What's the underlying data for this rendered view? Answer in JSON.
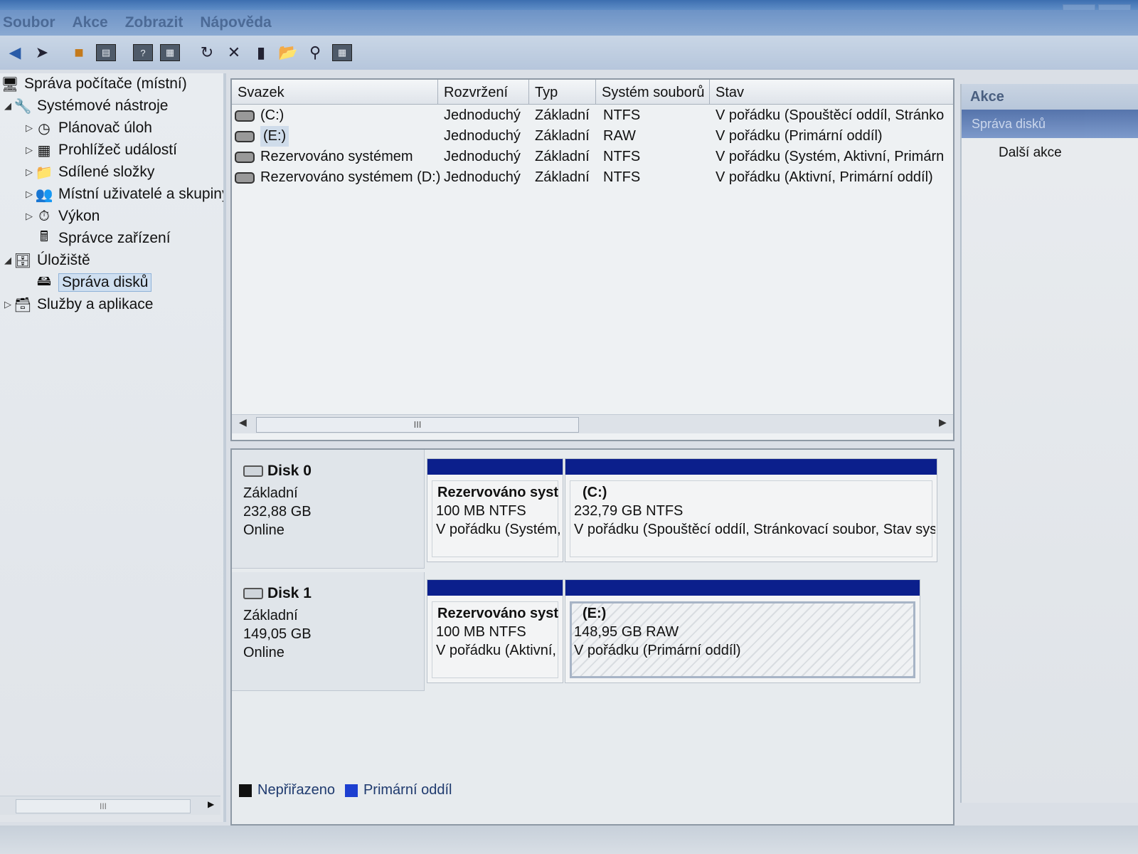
{
  "menu": [
    "Soubor",
    "Akce",
    "Zobrazit",
    "Nápověda"
  ],
  "tree": {
    "root": "Správa počítače (místní)",
    "system_tools": "Systémové nástroje",
    "task_scheduler": "Plánovač úloh",
    "event_viewer": "Prohlížeč událostí",
    "shared_folders": "Sdílené složky",
    "local_users": "Místní uživatelé a skupiny",
    "performance": "Výkon",
    "device_manager": "Správce zařízení",
    "storage": "Úložiště",
    "disk_management": "Správa disků",
    "services_apps": "Služby a aplikace"
  },
  "volumes": {
    "headers": [
      "Svazek",
      "Rozvržení",
      "Typ",
      "Systém souborů",
      "Stav"
    ],
    "rows": [
      {
        "name": "(C:)",
        "layout": "Jednoduchý",
        "type": "Základní",
        "fs": "NTFS",
        "status": "V pořádku (Spouštěcí oddíl, Stránko"
      },
      {
        "name": "(E:)",
        "layout": "Jednoduchý",
        "type": "Základní",
        "fs": "RAW",
        "status": "V pořádku (Primární oddíl)"
      },
      {
        "name": "Rezervováno systémem",
        "layout": "Jednoduchý",
        "type": "Základní",
        "fs": "NTFS",
        "status": "V pořádku (Systém, Aktivní, Primárn"
      },
      {
        "name": "Rezervováno systémem (D:)",
        "layout": "Jednoduchý",
        "type": "Základní",
        "fs": "NTFS",
        "status": "V pořádku (Aktivní, Primární oddíl)"
      }
    ],
    "scroll_grip": "III"
  },
  "disks": [
    {
      "title": "Disk 0",
      "type": "Základní",
      "size": "232,88 GB",
      "state": "Online",
      "partitions": [
        {
          "name": "Rezervováno syst",
          "size": "100 MB NTFS",
          "status": "V pořádku (Systém,"
        },
        {
          "name": "(C:)",
          "size": "232,79 GB NTFS",
          "status": "V pořádku (Spouštěcí oddíl, Stránkovací soubor, Stav syst"
        }
      ]
    },
    {
      "title": "Disk 1",
      "type": "Základní",
      "size": "149,05 GB",
      "state": "Online",
      "partitions": [
        {
          "name": "Rezervováno syst",
          "size": "100 MB NTFS",
          "status": "V pořádku (Aktivní,"
        },
        {
          "name": "(E:)",
          "size": "148,95 GB RAW",
          "status": "V pořádku (Primární oddíl)"
        }
      ]
    }
  ],
  "legend": {
    "unallocated": "Nepřiřazeno",
    "primary": "Primární oddíl",
    "unallocated_color": "#111111",
    "primary_color": "#1d3fd0"
  },
  "actions": {
    "header": "Akce",
    "selected": "Správa disků",
    "more": "Další akce"
  },
  "tree_scroll_grip": "III",
  "colors": {
    "partition_bar": "#0b1f8c",
    "selection": "#cfdff0"
  }
}
